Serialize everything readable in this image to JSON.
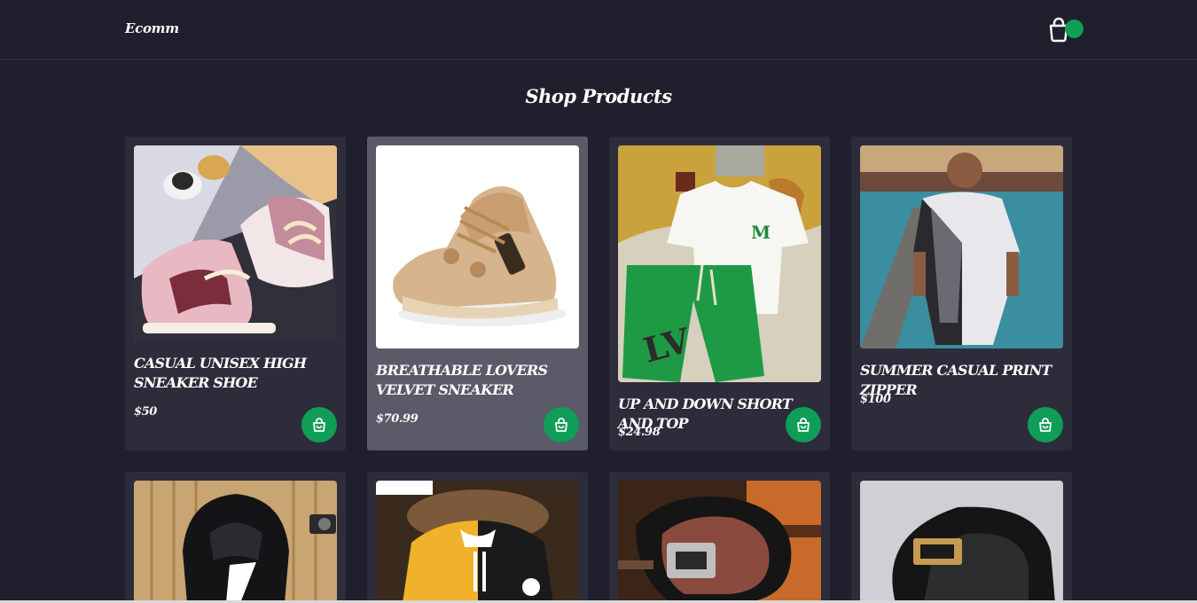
{
  "header": {
    "brand": "Ecomm",
    "cart_icon": "shopping-bag-icon",
    "badge_color": "#0f9d58"
  },
  "page": {
    "title": "Shop Products"
  },
  "products": [
    {
      "name": "CASUAL UNISEX HIGH SNEAKER SHOE",
      "price": "$50"
    },
    {
      "name": "BREATHABLE LOVERS VELVET SNEAKER",
      "price": "$70.99"
    },
    {
      "name": "UP AND DOWN SHORT AND TOP",
      "price": "$24.98"
    },
    {
      "name": "SUMMER CASUAL PRINT ZIPPER",
      "price": "$100"
    }
  ],
  "theme": {
    "background": "#1f1f2d",
    "card": "#2c2c3a",
    "card_hover": "#5a5a68",
    "accent": "#0f9d58"
  }
}
